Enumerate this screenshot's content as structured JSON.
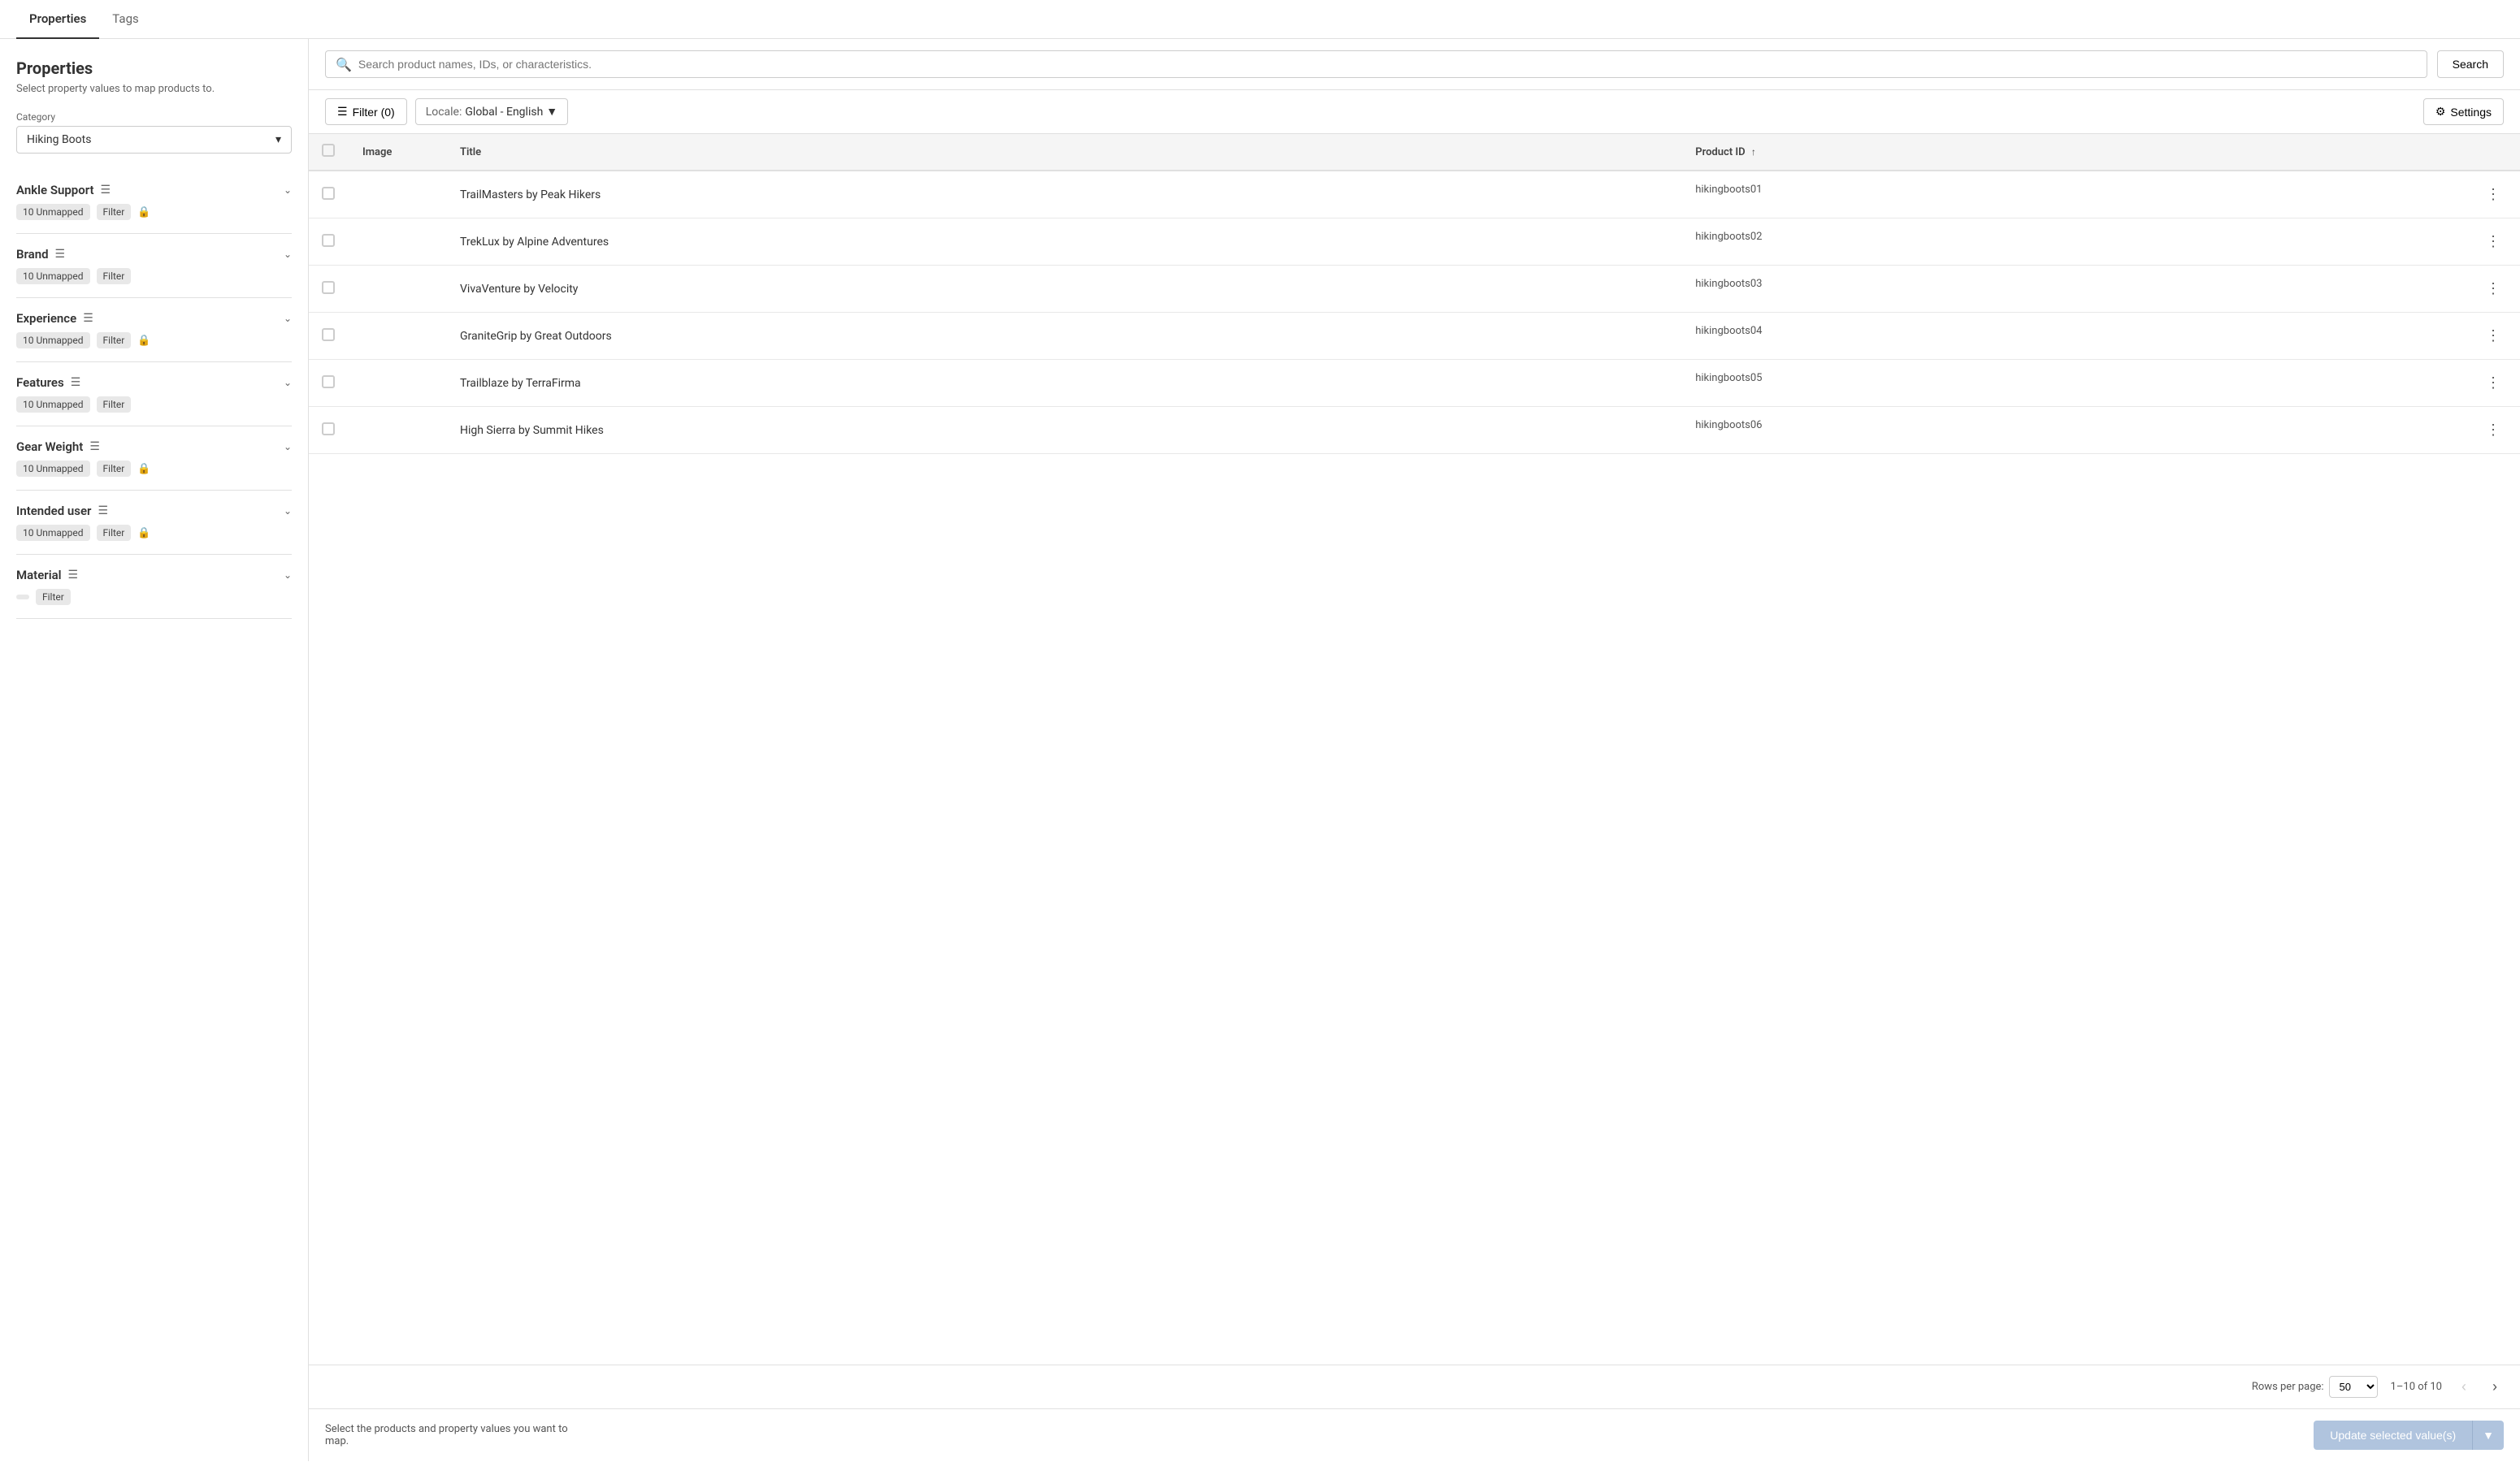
{
  "tabs": [
    {
      "id": "properties",
      "label": "Properties",
      "active": true
    },
    {
      "id": "tags",
      "label": "Tags",
      "active": false
    }
  ],
  "sidebar": {
    "title": "Properties",
    "subtitle": "Select property values to map products to.",
    "category": {
      "label": "Category",
      "value": "Hiking Boots"
    },
    "properties": [
      {
        "id": "ankle-support",
        "name": "Ankle Support",
        "unmapped": "10 Unmapped",
        "hasFilter": true,
        "hasLock": true,
        "expanded": false
      },
      {
        "id": "brand",
        "name": "Brand",
        "unmapped": "10 Unmapped",
        "hasFilter": true,
        "hasLock": false,
        "expanded": false
      },
      {
        "id": "experience",
        "name": "Experience",
        "unmapped": "10 Unmapped",
        "hasFilter": true,
        "hasLock": true,
        "expanded": false
      },
      {
        "id": "features",
        "name": "Features",
        "unmapped": "10 Unmapped",
        "hasFilter": true,
        "hasLock": false,
        "expanded": false
      },
      {
        "id": "gear-weight",
        "name": "Gear Weight",
        "unmapped": "10 Unmapped",
        "hasFilter": true,
        "hasLock": true,
        "expanded": false
      },
      {
        "id": "intended-user",
        "name": "Intended user",
        "unmapped": "10 Unmapped",
        "hasFilter": true,
        "hasLock": true,
        "expanded": false
      },
      {
        "id": "material",
        "name": "Material",
        "unmapped": "",
        "hasFilter": true,
        "hasLock": false,
        "expanded": false
      }
    ]
  },
  "toolbar": {
    "search_placeholder": "Search product names, IDs, or characteristics.",
    "search_label": "Search",
    "filter_label": "Filter (0)",
    "locale_label": "Locale:",
    "locale_value": "Global - English",
    "settings_label": "Settings"
  },
  "table": {
    "columns": [
      {
        "id": "checkbox",
        "label": ""
      },
      {
        "id": "image",
        "label": "Image"
      },
      {
        "id": "title",
        "label": "Title"
      },
      {
        "id": "product_id",
        "label": "Product ID",
        "sortable": true,
        "sort_direction": "asc"
      }
    ],
    "rows": [
      {
        "id": 1,
        "title": "TrailMasters by Peak Hikers",
        "product_id": "hikingboots01"
      },
      {
        "id": 2,
        "title": "TrekLux by Alpine Adventures",
        "product_id": "hikingboots02"
      },
      {
        "id": 3,
        "title": "VivaVenture by Velocity",
        "product_id": "hikingboots03"
      },
      {
        "id": 4,
        "title": "GraniteGrip by Great Outdoors",
        "product_id": "hikingboots04"
      },
      {
        "id": 5,
        "title": "Trailblaze by TerraFirma",
        "product_id": "hikingboots05"
      },
      {
        "id": 6,
        "title": "High Sierra by Summit Hikes",
        "product_id": "hikingboots06"
      }
    ],
    "rows_per_page_label": "Rows per page:",
    "rows_per_page_value": "50",
    "pagination_info": "1–10 of 10"
  },
  "action_bar": {
    "text": "Select the products and property values you want to map.",
    "update_label": "Update selected value(s)"
  }
}
